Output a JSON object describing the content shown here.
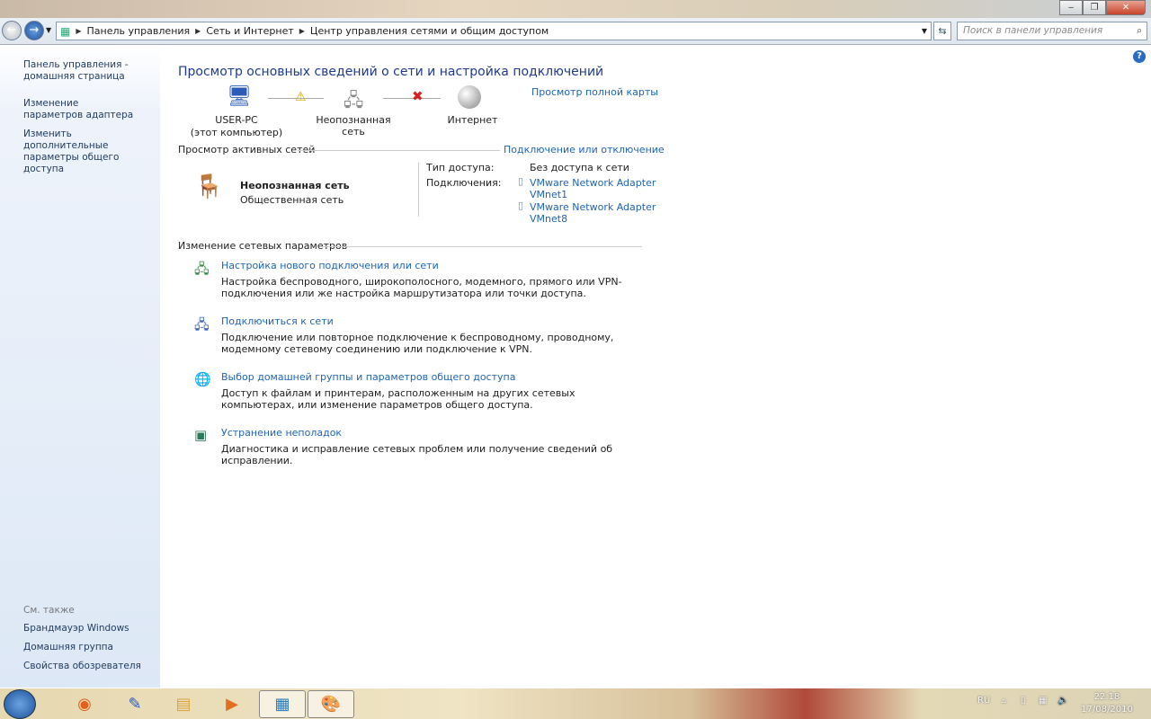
{
  "window": {
    "controls": {
      "minimize": "‒",
      "maximize": "❐",
      "close": "✕"
    }
  },
  "address": {
    "crumbs": [
      "Панель управления",
      "Сеть и Интернет",
      "Центр управления сетями и общим доступом"
    ],
    "search_placeholder": "Поиск в панели управления"
  },
  "sidebar": {
    "links": [
      "Панель управления - домашняя страница",
      "Изменение параметров адаптера",
      "Изменить дополнительные параметры общего доступа"
    ],
    "see_also_title": "См. также",
    "see_also": [
      "Брандмауэр Windows",
      "Домашняя группа",
      "Свойства обозревателя"
    ]
  },
  "main": {
    "title": "Просмотр основных сведений о сети и настройка подключений",
    "full_map": "Просмотр полной карты",
    "map": {
      "computer": "USER-PC",
      "computer_sub": "(этот компьютер)",
      "network": "Неопознанная сеть",
      "internet": "Интернет"
    },
    "active_title": "Просмотр активных сетей",
    "connect_disconnect": "Подключение или отключение",
    "network_name": "Неопознанная сеть",
    "network_type": "Общественная сеть",
    "access_label": "Тип доступа:",
    "access_value": "Без доступа к сети",
    "connections_label": "Подключения:",
    "connections": [
      {
        "l1": "VMware Network Adapter",
        "l2": "VMnet1"
      },
      {
        "l1": "VMware Network Adapter",
        "l2": "VMnet8"
      }
    ],
    "change_title": "Изменение сетевых параметров",
    "tasks": [
      {
        "title": "Настройка нового подключения или сети",
        "desc": "Настройка беспроводного, широкополосного, модемного, прямого или VPN-подключения или же настройка маршрутизатора или точки доступа."
      },
      {
        "title": "Подключиться к сети",
        "desc": "Подключение или повторное подключение к беспроводному, проводному, модемному сетевому соединению или подключение к VPN."
      },
      {
        "title": "Выбор домашней группы и параметров общего доступа",
        "desc": "Доступ к файлам и принтерам, расположенным на других сетевых компьютерах, или изменение параметров общего доступа."
      },
      {
        "title": "Устранение неполадок",
        "desc": "Диагностика и исправление сетевых проблем или получение сведений об исправлении."
      }
    ]
  },
  "taskbar": {
    "lang": "RU",
    "time": "22:18",
    "date": "17/08/2010"
  }
}
